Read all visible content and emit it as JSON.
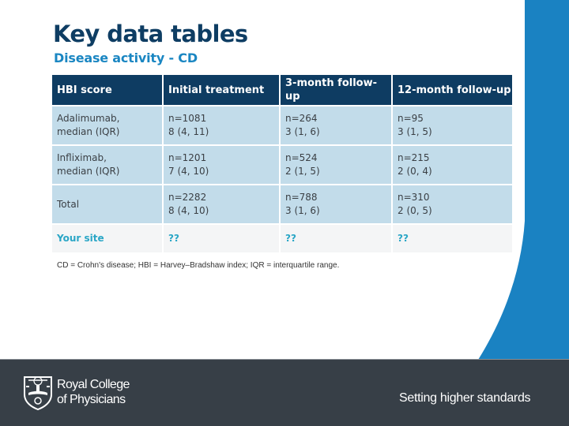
{
  "slide": {
    "title": "Key data tables",
    "subtitle": "Disease activity - CD",
    "footnote": "CD = Crohn's disease; HBI = Harvey–Bradshaw index; IQR = interquartile range."
  },
  "table": {
    "headers": [
      "HBI score",
      "Initial treatment",
      "3-month follow-up",
      "12-month follow-up"
    ],
    "rows": [
      {
        "label": [
          "Adalimumab,",
          "median (IQR)"
        ],
        "cells": [
          [
            "n=1081",
            "8 (4, 11)"
          ],
          [
            "n=264",
            "3 (1, 6)"
          ],
          [
            "n=95",
            "3 (1, 5)"
          ]
        ]
      },
      {
        "label": [
          "Infliximab,",
          "median (IQR)"
        ],
        "cells": [
          [
            "n=1201",
            "7 (4, 10)"
          ],
          [
            "n=524",
            "2 (1, 5)"
          ],
          [
            "n=215",
            "2 (0, 4)"
          ]
        ]
      },
      {
        "label": [
          "Total"
        ],
        "cells": [
          [
            "n=2282",
            "8 (4, 10)"
          ],
          [
            "n=788",
            "3 (1, 6)"
          ],
          [
            "n=310",
            "2 (0, 5)"
          ]
        ]
      },
      {
        "label": [
          "Your site"
        ],
        "cells": [
          [
            "??"
          ],
          [
            "??"
          ],
          [
            "??"
          ]
        ],
        "highlight": true
      }
    ]
  },
  "footer": {
    "org_line1": "Royal College",
    "org_line2": "of Physicians",
    "tagline": "Setting higher standards",
    "logo_icon": "rcp-crest-icon"
  },
  "colors": {
    "title": "#0e3d63",
    "subtitle": "#1a86c2",
    "header_bg": "#0e3c62",
    "row_bg": "#c2dcea",
    "site_row_bg": "#f4f5f6",
    "site_text": "#2aa6c6",
    "accent_blue": "#1a82c2",
    "footer_bg": "#373f47"
  }
}
